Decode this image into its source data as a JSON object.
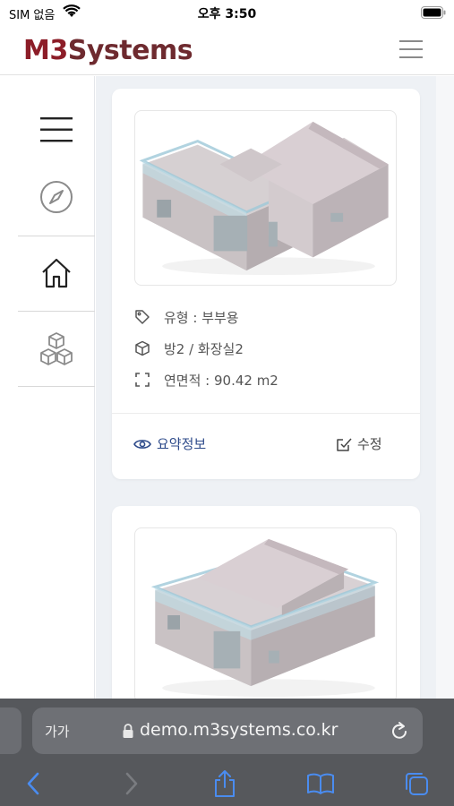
{
  "status_bar": {
    "carrier": "SIM 없음",
    "time": "오후 3:50"
  },
  "header": {
    "logo_part1": "M3",
    "logo_part2": "Systems"
  },
  "cards": [
    {
      "type_label": "유형 : 부부용",
      "rooms_label": "방2 / 화장실2",
      "area_label": "연면적 : 90.42 m2",
      "summary_label": "요약정보",
      "edit_label": "수정"
    },
    {}
  ],
  "browser": {
    "text_size_label": "가가",
    "url": "demo.m3systems.co.kr"
  },
  "colors": {
    "brand": "#8c1d28",
    "link": "#2d4a8a",
    "content_bg": "#eef1f5",
    "browser_bar": "#56585c"
  },
  "icons": {
    "rail": [
      "menu-icon",
      "compass-icon",
      "home-icon",
      "cubes-icon"
    ],
    "card_rows": [
      "tag-icon",
      "box-icon",
      "expand-icon"
    ],
    "card_actions": [
      "eye-icon",
      "edit-icon"
    ],
    "toolbar": [
      "back-icon",
      "forward-icon",
      "share-icon",
      "bookmarks-icon",
      "tabs-icon"
    ]
  }
}
